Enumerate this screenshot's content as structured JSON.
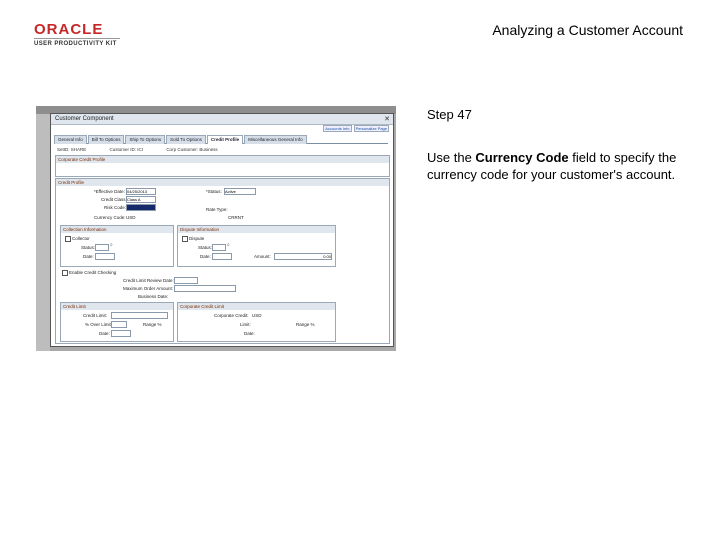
{
  "header": {
    "logo_oracle": "ORACLE",
    "logo_sub": "USER PRODUCTIVITY KIT",
    "doc_title": "Analyzing a Customer Account"
  },
  "step": {
    "label": "Step 47"
  },
  "instruction": {
    "pre": "Use the ",
    "field": "Currency Code",
    "post": " field to specify the currency code for your customer's account."
  },
  "screenshot": {
    "modal_title": "Customer Component",
    "tabs": [
      "General Info",
      "Bill To Options",
      "Ship To Options",
      "Sold To Options",
      "Credit Profile",
      "Miscellaneous General Info"
    ],
    "active_tab": "Credit Profile",
    "top_links": [
      "Accounts Info",
      "Personalize Page"
    ],
    "key_fields": [
      "SetID: SHARE",
      "Customer ID: ICI",
      "Corp Customer: Business"
    ],
    "corporate_credit_profile": "Corporate Credit Profile",
    "credit_profile": {
      "header": "Credit Profile",
      "effective_date_label": "*Effective Date:",
      "effective_date": "04/25/2013",
      "status_label": "*Status:",
      "status": "Active",
      "credit_class_label": "Credit Class:",
      "credit_class": "Class A",
      "risk_code_label": "Risk Code:",
      "currency_code_label": "Currency Code:",
      "currency_code": "USD",
      "rate_type_label": "Rate Type:",
      "rate_type": "CRRNT"
    },
    "collection_info": {
      "header": "Collection Information",
      "collector_label": "Collector",
      "status_label": "Status:",
      "date_label": "Date:"
    },
    "dispute_info": {
      "header": "Dispute Information",
      "dispute_label": "Dispute",
      "status_label": "Status:",
      "date_label": "Date:",
      "amount_label": "Amount:",
      "amount": "0.00"
    },
    "enable_credit_checking": "Enable Credit Checking",
    "credit_limit_review_date": "Credit Limit Review Date:",
    "maximum_order_amount": "Maximum Order Amount:",
    "business_date": "Business Date:",
    "credit_limit_box": {
      "header": "Credit Limit",
      "credit_limit": "Credit Limit:",
      "pct_over_limit": "% Over Limit:",
      "date": "Date:",
      "range": "Range %"
    },
    "corporate_credit_limit": {
      "header": "Corporate Credit Limit",
      "corporate_credit": "Corporate Credit:",
      "usd": "USD",
      "limit": "Limit:",
      "range": "Range %",
      "date": "Date:"
    }
  }
}
